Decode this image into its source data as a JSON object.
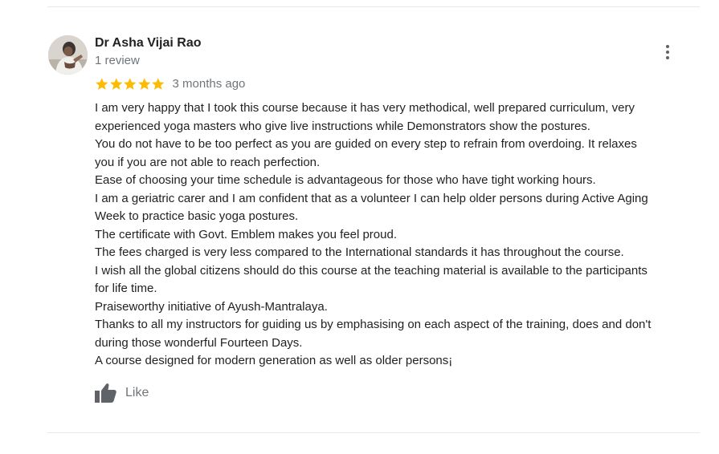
{
  "review": {
    "reviewer_name": "Dr Asha Vijai Rao",
    "review_count": "1 review",
    "rating": 5,
    "rating_max": 5,
    "time": "3 months ago",
    "star_color": "#fbbc04",
    "lines": [
      "I am very happy that I took this course because it has very methodical, well prepared curriculum, very",
      "experienced yoga masters who give live instructions while  Demonstrators show the postures.",
      "You do not have to be too perfect as you are guided on every step to refrain from overdoing. It relaxes",
      "you if you are not able to reach perfection.",
      "Ease of choosing your time schedule is  advantageous for those who have tight working hours.",
      "I am a geriatric carer and I am confident that as a volunteer I can help older persons during Active Aging",
      "Week to practice basic yoga postures.",
      "The certificate with Govt. Emblem makes you feel proud.",
      "The fees charged is very less compared to the International standards it has throughout the course.",
      "I wish all the global citizens should do this course at the teaching material is available to the participants",
      "for life time.",
      "Praiseworthy initiative of Ayush-Mantralaya.",
      "Thanks to all my instructors for guiding us by emphasising on each aspect of the training, does and don't",
      "during those wonderful Fourteen Days.",
      "A course designed for modern generation as well as older persons¡"
    ],
    "like_label": "Like",
    "more_icon": "more-vertical-icon",
    "like_icon": "thumbs-up-icon"
  }
}
